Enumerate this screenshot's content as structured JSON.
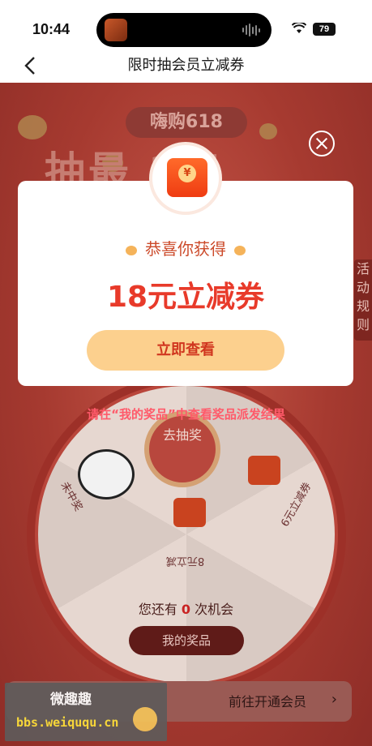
{
  "status_bar": {
    "time": "10:44",
    "battery": "79"
  },
  "nav": {
    "title": "限时抽会员立减券"
  },
  "background": {
    "tag": "嗨购618",
    "headline": "抽最  2元",
    "side_rules": "活动规则",
    "wheel_center": "去抽奖",
    "segments": [
      "未中奖",
      "6元立减券",
      "8元立减"
    ],
    "chance_prefix": "您还有",
    "chance_count": "0",
    "chance_suffix": "次机会",
    "my_prizes": "我的奖品",
    "member_link": "前往开通会员",
    "member_arrow": "›"
  },
  "modal": {
    "congrats": "恭喜你获得",
    "prize": "18元立减券",
    "button": "立即查看",
    "envelope_symbol": "¥"
  },
  "notice": "请在“我的奖品”中查看奖品派发结果",
  "watermark": {
    "title": "微趣趣",
    "url": "bbs.weiququ.cn"
  }
}
